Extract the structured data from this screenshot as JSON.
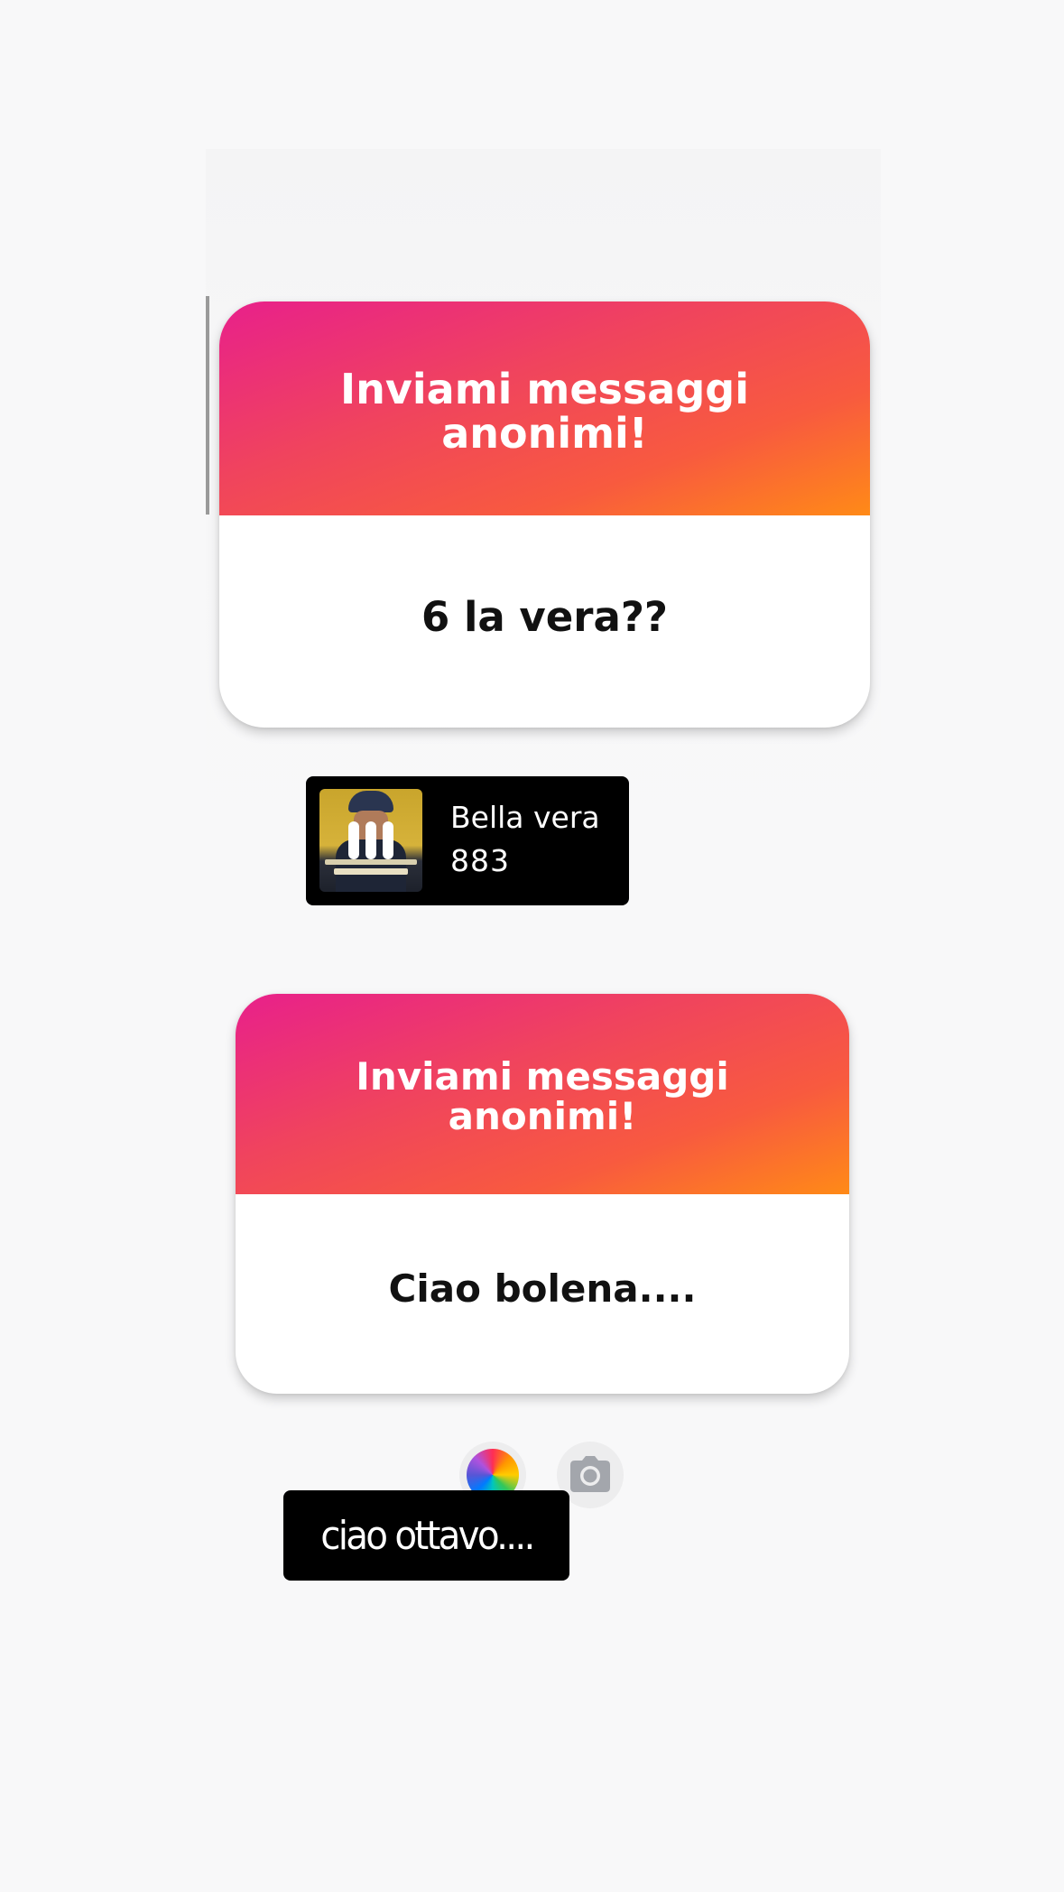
{
  "cards": [
    {
      "title": "Inviami messaggi anonimi!",
      "answer": "6 la vera??"
    },
    {
      "title": "Inviami messaggi anonimi!",
      "answer": "Ciao bolena...."
    }
  ],
  "music": {
    "title": "Bella vera",
    "artist": "883",
    "state_icon": "pause-icon"
  },
  "tools": {
    "color_picker_icon": "color-wheel-icon",
    "camera_icon": "camera-icon"
  },
  "text_sticker": {
    "text": "ciao ottavo...."
  },
  "colors": {
    "gradient_start": "#e8208b",
    "gradient_end": "#ff8a17",
    "background": "#f8f8f9"
  }
}
